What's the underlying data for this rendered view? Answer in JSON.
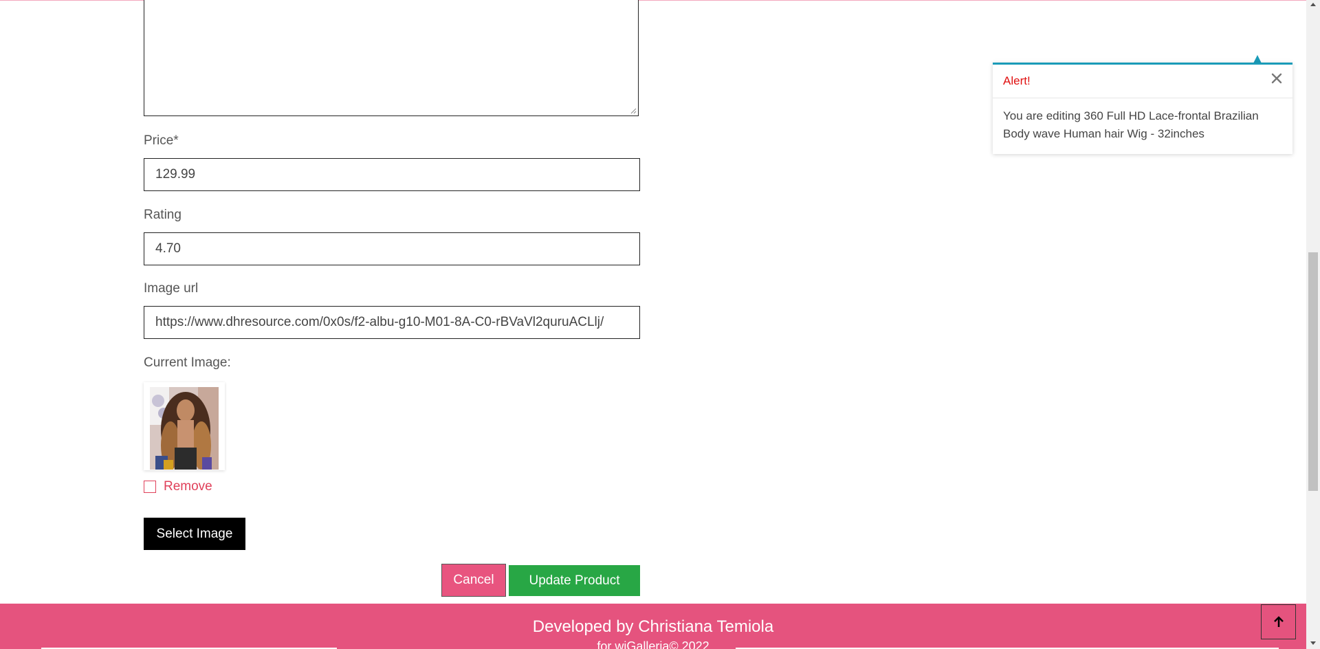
{
  "form": {
    "description_value": "",
    "price_label": "Price*",
    "price_value": "129.99",
    "rating_label": "Rating",
    "rating_value": "4.70",
    "image_url_label": "Image url",
    "image_url_value": "https://www.dhresource.com/0x0s/f2-albu-g10-M01-8A-C0-rBVaVl2quruACLlj/",
    "current_image_label": "Current Image:",
    "remove_label": "Remove",
    "remove_checked": false,
    "select_image_label": "Select Image",
    "cancel_label": "Cancel",
    "update_label": "Update Product"
  },
  "toast": {
    "title": "Alert!",
    "message": "You are editing 360 Full HD Lace-frontal Brazilian Body wave Human hair Wig - 32inches",
    "accent_color": "#1a9bb8",
    "title_color": "#e01010",
    "close_icon": "close-icon"
  },
  "footer": {
    "developer_text": "Developed by Christiana Temiola",
    "copyright_text": "for wiGalleria© 2022",
    "background_color": "#e5537e"
  },
  "back_to_top": {
    "icon": "arrow-up-icon"
  },
  "colors": {
    "remove": "#e0405a",
    "cancel_button": "#e8547f",
    "update_button": "#28a745",
    "select_button": "#000000"
  }
}
